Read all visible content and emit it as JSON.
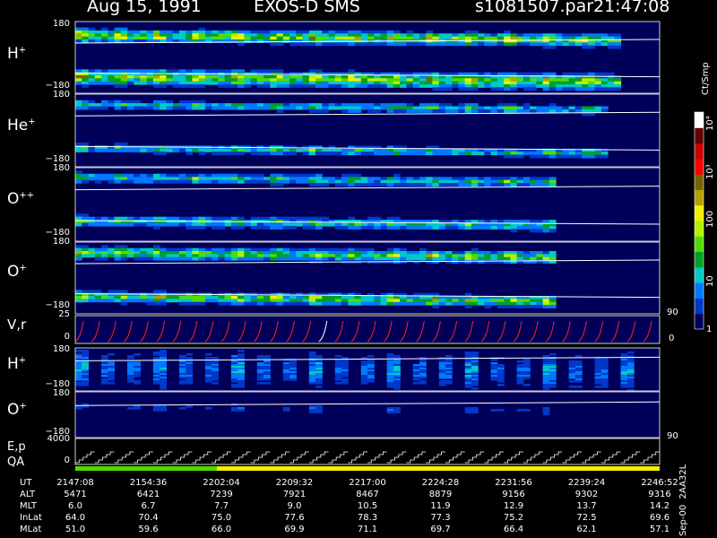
{
  "header": {
    "date": "Aug 15, 1991",
    "instrument": "EXOS-D SMS",
    "file": "s1081507.par",
    "time": "21:47:08"
  },
  "colorbar": {
    "unit": "Ct/Smp",
    "ticks": [
      "1",
      "10",
      "100",
      "10³",
      "10⁴"
    ],
    "colors": [
      "#00005a",
      "#0038c8",
      "#0078ff",
      "#00c8c8",
      "#00a028",
      "#50dc00",
      "#b4f000",
      "#f0f000",
      "#b4a000",
      "#786400",
      "#ff0000",
      "#c80000",
      "#640000",
      "#ffffff"
    ]
  },
  "panels": [
    {
      "label": "H",
      "sup": "+",
      "top_tick": "180",
      "bottom_tick": "−180"
    },
    {
      "label": "He",
      "sup": "+",
      "top_tick": "180",
      "bottom_tick": "−180"
    },
    {
      "label": "O",
      "sup": "++",
      "top_tick": "180",
      "bottom_tick": "−180"
    },
    {
      "label": "O",
      "sup": "+",
      "top_tick": "180",
      "bottom_tick": "−180"
    },
    {
      "label": "V,r",
      "sup": "",
      "top_tick": "25",
      "bottom_tick": "0"
    },
    {
      "label": "H",
      "sup": "+",
      "top_tick": "180",
      "bottom_tick": "−180"
    },
    {
      "label": "O",
      "sup": "+",
      "top_tick": "180",
      "bottom_tick": "−180"
    },
    {
      "label": "E,p",
      "sup": "",
      "top_tick": "4000",
      "bottom_tick": "0"
    }
  ],
  "qa_label": "QA",
  "right_ticks": {
    "vr_top": "90",
    "vr_bottom": "0",
    "o_bottom": "90"
  },
  "chart_data": {
    "type": "heatmap",
    "title": "Aug 15, 1991   EXOS-D SMS",
    "xlabel": "UT",
    "x": [
      "2147:08",
      "2154:36",
      "2202:04",
      "2209:32",
      "2217:00",
      "2224:28",
      "2231:56",
      "2239:24",
      "2246:52"
    ],
    "rows": [
      {
        "name": "UT",
        "values": [
          "2147:08",
          "2154:36",
          "2202:04",
          "2209:32",
          "2217:00",
          "2224:28",
          "2231:56",
          "2239:24",
          "2246:52"
        ]
      },
      {
        "name": "ALT",
        "values": [
          "5471",
          "6421",
          "7239",
          "7921",
          "8467",
          "8879",
          "9156",
          "9302",
          "9316"
        ]
      },
      {
        "name": "MLT",
        "values": [
          "6.0",
          "6.7",
          "7.7",
          "9.0",
          "10.5",
          "11.9",
          "12.9",
          "13.7",
          "14.2"
        ]
      },
      {
        "name": "InLat",
        "values": [
          "64.0",
          "70.4",
          "75.0",
          "77.6",
          "78.3",
          "77.3",
          "75.2",
          "72.5",
          "69.6"
        ]
      },
      {
        "name": "MLat",
        "values": [
          "51.0",
          "59.6",
          "66.0",
          "69.9",
          "71.1",
          "69.7",
          "66.4",
          "62.1",
          "57.1"
        ]
      }
    ],
    "ylim": [
      -180,
      180
    ],
    "colorbar_range": [
      1,
      10000
    ],
    "colorbar_scale": "log",
    "qa": {
      "green_until": "2202:04",
      "rest": "yellow"
    }
  },
  "footer": {
    "side_note": "Sep-00  2AA32L"
  }
}
